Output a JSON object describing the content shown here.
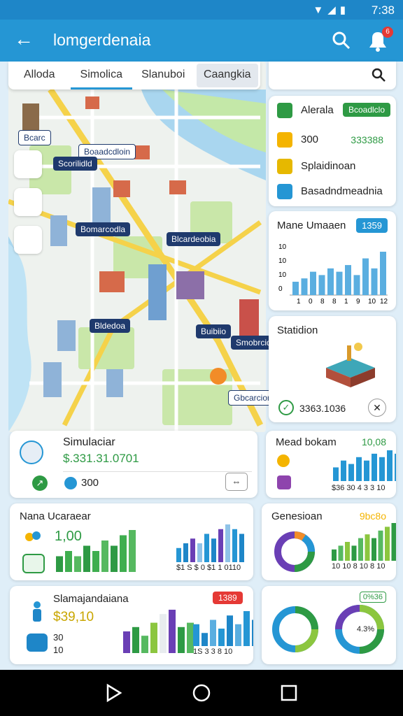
{
  "status": {
    "time": "7:38",
    "icons": "▼◢▮"
  },
  "appbar": {
    "title": "lomgerdenaia",
    "badge": "6"
  },
  "tabs": [
    "Alloda",
    "Simolica",
    "Slanuboi",
    "Caangkia"
  ],
  "map_labels": [
    "Bcarc",
    "Boaadcdloin",
    "Scorilidld",
    "Bomarcodla",
    "Blcardeobia",
    "Bldedoa",
    "Buibiio",
    "Smobrcid",
    "Gbcarciora"
  ],
  "layers": [
    {
      "label": "Alerala",
      "pill": "Bcoadlclo"
    },
    {
      "label": "300",
      "value": "333388"
    },
    {
      "label": "Splaidinoan"
    },
    {
      "label": "Basadndmeadnia"
    }
  ],
  "metric": {
    "title": "Mane Umaaen",
    "pill": "1359",
    "ylabels": [
      "10",
      "10",
      "10",
      "0"
    ],
    "xlabels": [
      "1",
      "0",
      "8",
      "8",
      "1",
      "9",
      "10",
      "12"
    ],
    "values": [
      4,
      5,
      7,
      6,
      8,
      7,
      9,
      6,
      11,
      8,
      13
    ]
  },
  "station": {
    "title": "Statidion",
    "stats": "3363.1036"
  },
  "sim": {
    "name": "Simulaciar",
    "money": "$.331.31.0701",
    "sval": "300"
  },
  "meal": {
    "title": "Mead bokam",
    "value": "10,08",
    "axis": "$36 30 4 3 3 10",
    "values": [
      4,
      6,
      5,
      7,
      6,
      8,
      7,
      9,
      8
    ]
  },
  "nana": {
    "title": "Nana Ucaraear",
    "value": "1,00",
    "axis": "$1 S $ 0 $1  1 0110",
    "left": [
      3,
      4,
      3,
      5,
      4,
      6,
      5,
      7,
      8
    ],
    "right": [
      3,
      4,
      5,
      4,
      6,
      5,
      7,
      8,
      7,
      6
    ]
  },
  "gen": {
    "title": "Genesioan",
    "value": "9bc8o",
    "axis": "10 10 8 10 8 10",
    "values": [
      3,
      4,
      5,
      4,
      6,
      7,
      6,
      8,
      9,
      10
    ]
  },
  "sla": {
    "title": "Slamajandaiana",
    "value": "$39,10",
    "red": "1389",
    "small1": "30",
    "small2": "10",
    "axis": "1S 3 3 8 10",
    "left": [
      5,
      6,
      4,
      7,
      9,
      10,
      6,
      7
    ],
    "right": [
      5,
      3,
      6,
      4,
      7,
      5,
      8,
      6
    ]
  },
  "donuts": {
    "tag": "0%36",
    "pct": "4.3%"
  },
  "colors": {
    "accent": "#2596d4",
    "green": "#2e9a44",
    "purple": "#6a3fb5"
  }
}
